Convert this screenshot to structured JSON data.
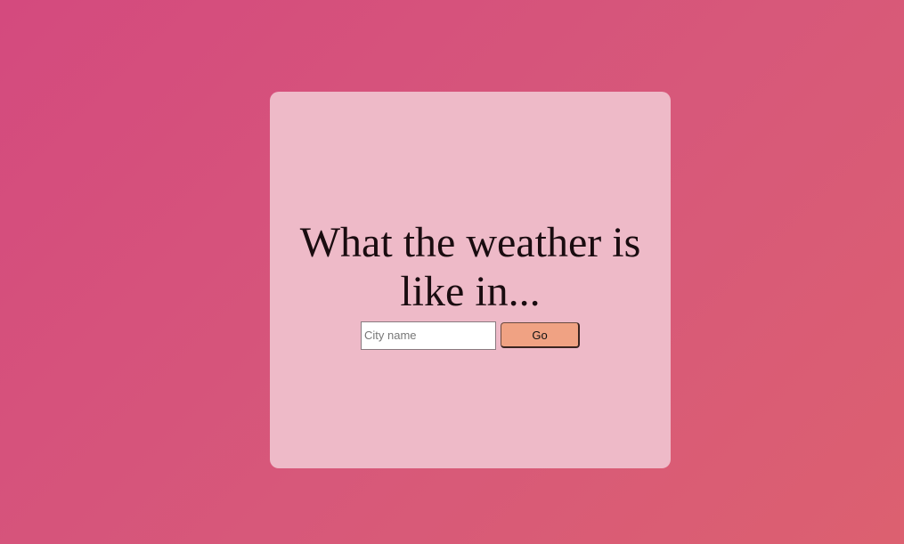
{
  "card": {
    "heading": "What the weather is like in..."
  },
  "search": {
    "placeholder": "City name",
    "value": "",
    "go_label": "Go"
  },
  "colors": {
    "background_start": "#d44a7e",
    "background_end": "#dc6070",
    "card": "#eebac8",
    "button": "#f0a283"
  }
}
